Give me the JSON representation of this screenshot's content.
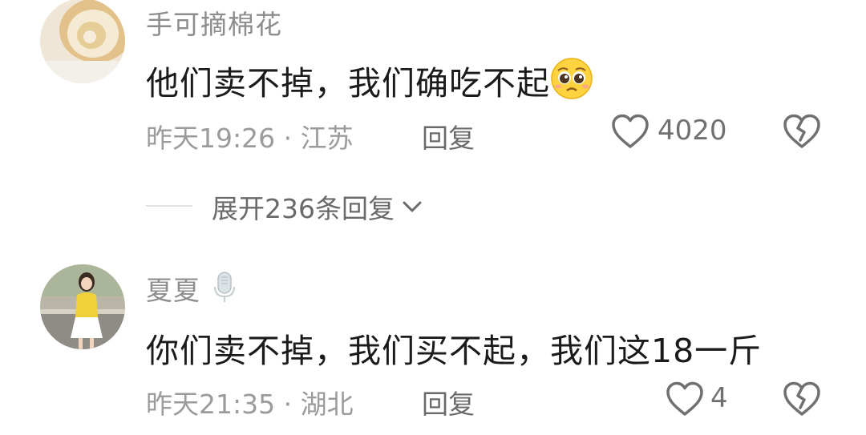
{
  "comments": [
    {
      "username": "手可摘棉花",
      "text": "他们卖不掉，我们确吃不起",
      "emoji": "pleading-face-emoji",
      "time": "昨天19:26",
      "separator": "·",
      "location": "江苏",
      "reply_label": "回复",
      "likes": "4020"
    },
    {
      "username": "夏夏",
      "badge": "microphone-badge-icon",
      "text": "你们卖不掉，我们买不起，我们这18一斤",
      "time": "昨天21:35",
      "separator": "·",
      "location": "湖北",
      "reply_label": "回复",
      "likes": "4"
    }
  ],
  "expand_replies": {
    "label": "展开236条回复"
  },
  "colors": {
    "username": "#8d8d8d",
    "text": "#1b1b1b",
    "meta": "#9b9b9b",
    "icon": "#707070"
  }
}
